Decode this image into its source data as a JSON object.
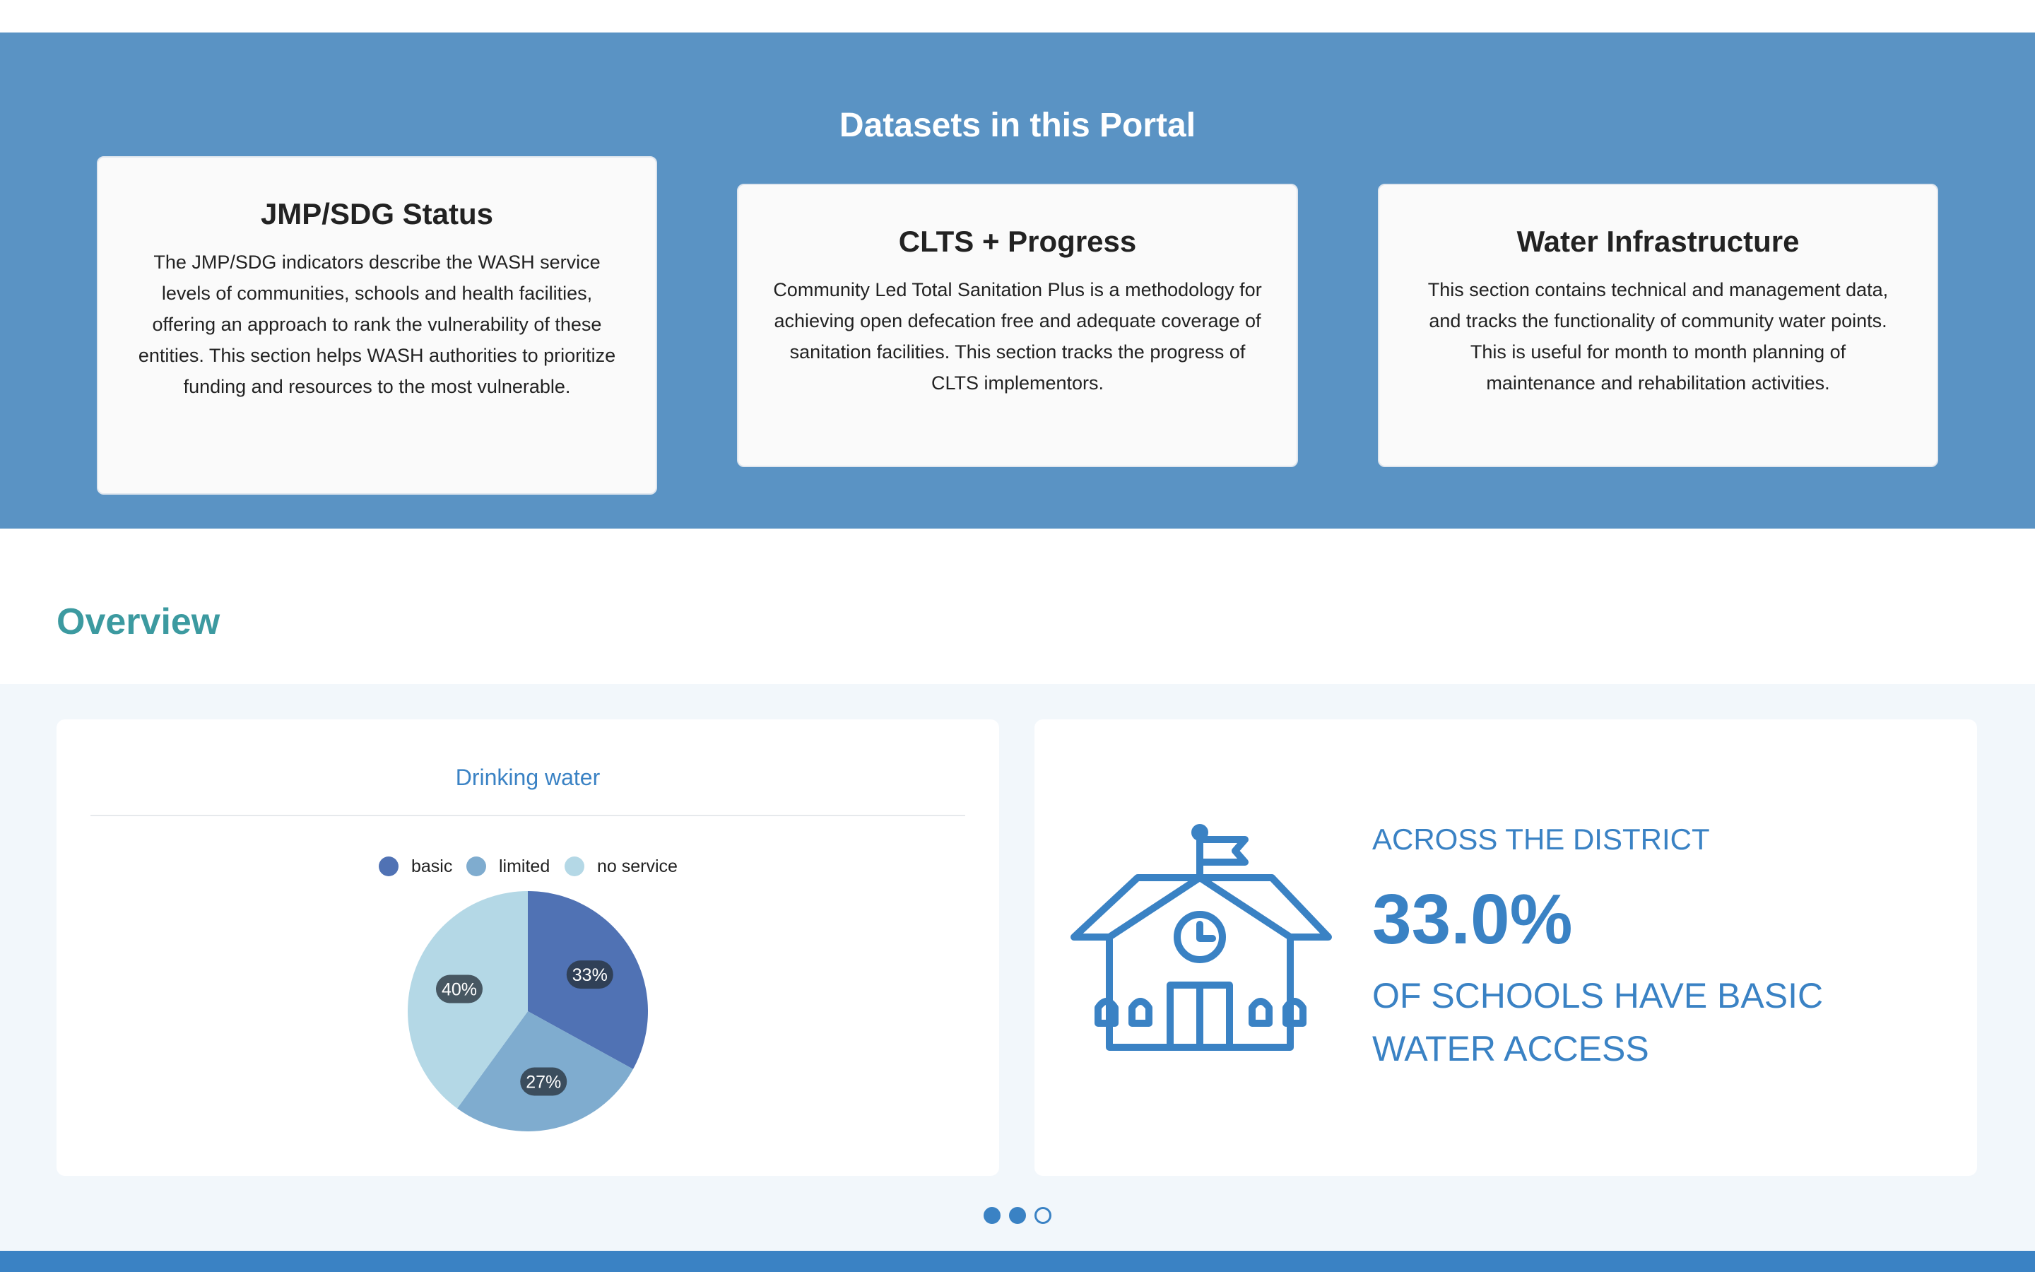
{
  "datasets": {
    "title": "Datasets in this Portal",
    "cards": [
      {
        "title": "JMP/SDG Status",
        "body": "The JMP/SDG indicators describe the WASH service levels of communities, schools and health facilities, offering an approach to rank the vulnerability of these entities. This section helps WASH authorities to prioritize funding and resources to the most vulnerable."
      },
      {
        "title": "CLTS + Progress",
        "body": "Community Led Total Sanitation Plus is a methodology for achieving open defecation free and adequate coverage of sanitation facilities. This section tracks the progress of CLTS implementors."
      },
      {
        "title": "Water Infrastructure",
        "body": "This section contains technical and management data, and tracks the functionality of community water points. This is useful for month to month planning of maintenance and rehabilitation activities."
      }
    ]
  },
  "overview": {
    "title": "Overview",
    "chart_panel": {
      "title": "Drinking water"
    },
    "stat_panel": {
      "upper": "ACROSS THE DISTRICT",
      "value": "33.0%",
      "lower": "OF SCHOOLS HAVE BASIC WATER ACCESS",
      "icon": "school-icon"
    },
    "carousel": {
      "count": 3,
      "active": [
        0,
        1
      ]
    }
  },
  "chart_data": {
    "type": "pie",
    "title": "Drinking water",
    "legend_position": "top",
    "categories": [
      "basic",
      "limited",
      "no service"
    ],
    "values": [
      33,
      27,
      40
    ],
    "labels": [
      "33%",
      "27%",
      "40%"
    ],
    "colors": [
      "#5072b4",
      "#7faccf",
      "#b4d8e6"
    ]
  },
  "colors": {
    "banner": "#5a93c4",
    "accent": "#3a82c4",
    "overview_title": "#3c9aa0",
    "band": "#f2f7fb"
  }
}
